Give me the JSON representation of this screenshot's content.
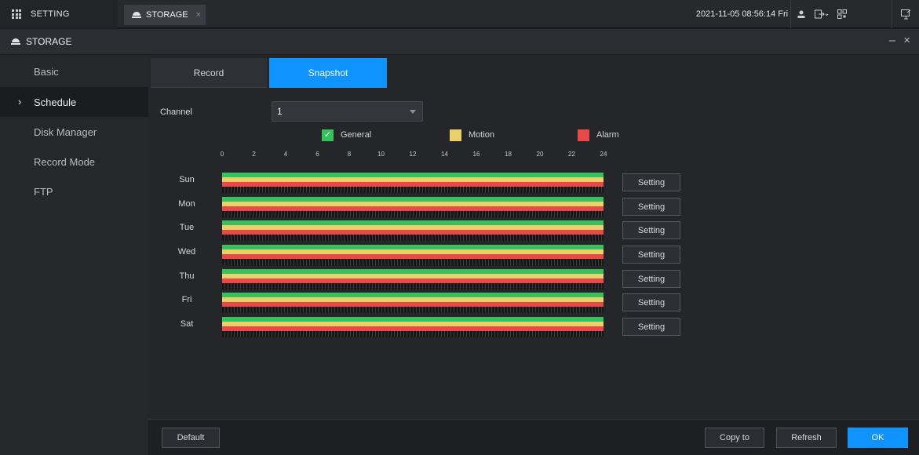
{
  "topbar": {
    "setting_label": "SETTING",
    "tab_label": "STORAGE",
    "tab_close": "×",
    "datetime": "2021-11-05 08:56:14 Fri",
    "icons": [
      "user-icon",
      "logout-icon",
      "qr-code-icon",
      "monitor-icon"
    ]
  },
  "titlebar": {
    "title": "STORAGE",
    "controls": "– ×"
  },
  "sidebar": {
    "items": [
      {
        "label": "Basic"
      },
      {
        "label": "Schedule",
        "active": true
      },
      {
        "label": "Disk Manager"
      },
      {
        "label": "Record Mode"
      },
      {
        "label": "FTP"
      }
    ]
  },
  "tabs": [
    {
      "label": "Record",
      "active": false
    },
    {
      "label": "Snapshot",
      "active": true
    }
  ],
  "channel": {
    "label": "Channel",
    "value": "1"
  },
  "legend": [
    {
      "label": "General",
      "color": "#37c05c",
      "checked": true
    },
    {
      "label": "Motion",
      "color": "#e9d06a",
      "checked": false
    },
    {
      "label": "Alarm",
      "color": "#e84848",
      "checked": false
    }
  ],
  "hours": [
    "0",
    "2",
    "4",
    "6",
    "8",
    "10",
    "12",
    "14",
    "16",
    "18",
    "20",
    "22",
    "24"
  ],
  "days": [
    {
      "label": "Sun",
      "button": "Setting"
    },
    {
      "label": "Mon",
      "button": "Setting"
    },
    {
      "label": "Tue",
      "button": "Setting"
    },
    {
      "label": "Wed",
      "button": "Setting"
    },
    {
      "label": "Thu",
      "button": "Setting"
    },
    {
      "label": "Fri",
      "button": "Setting"
    },
    {
      "label": "Sat",
      "button": "Setting"
    }
  ],
  "footer": {
    "default": "Default",
    "copy_to": "Copy to",
    "refresh": "Refresh",
    "ok": "OK"
  }
}
